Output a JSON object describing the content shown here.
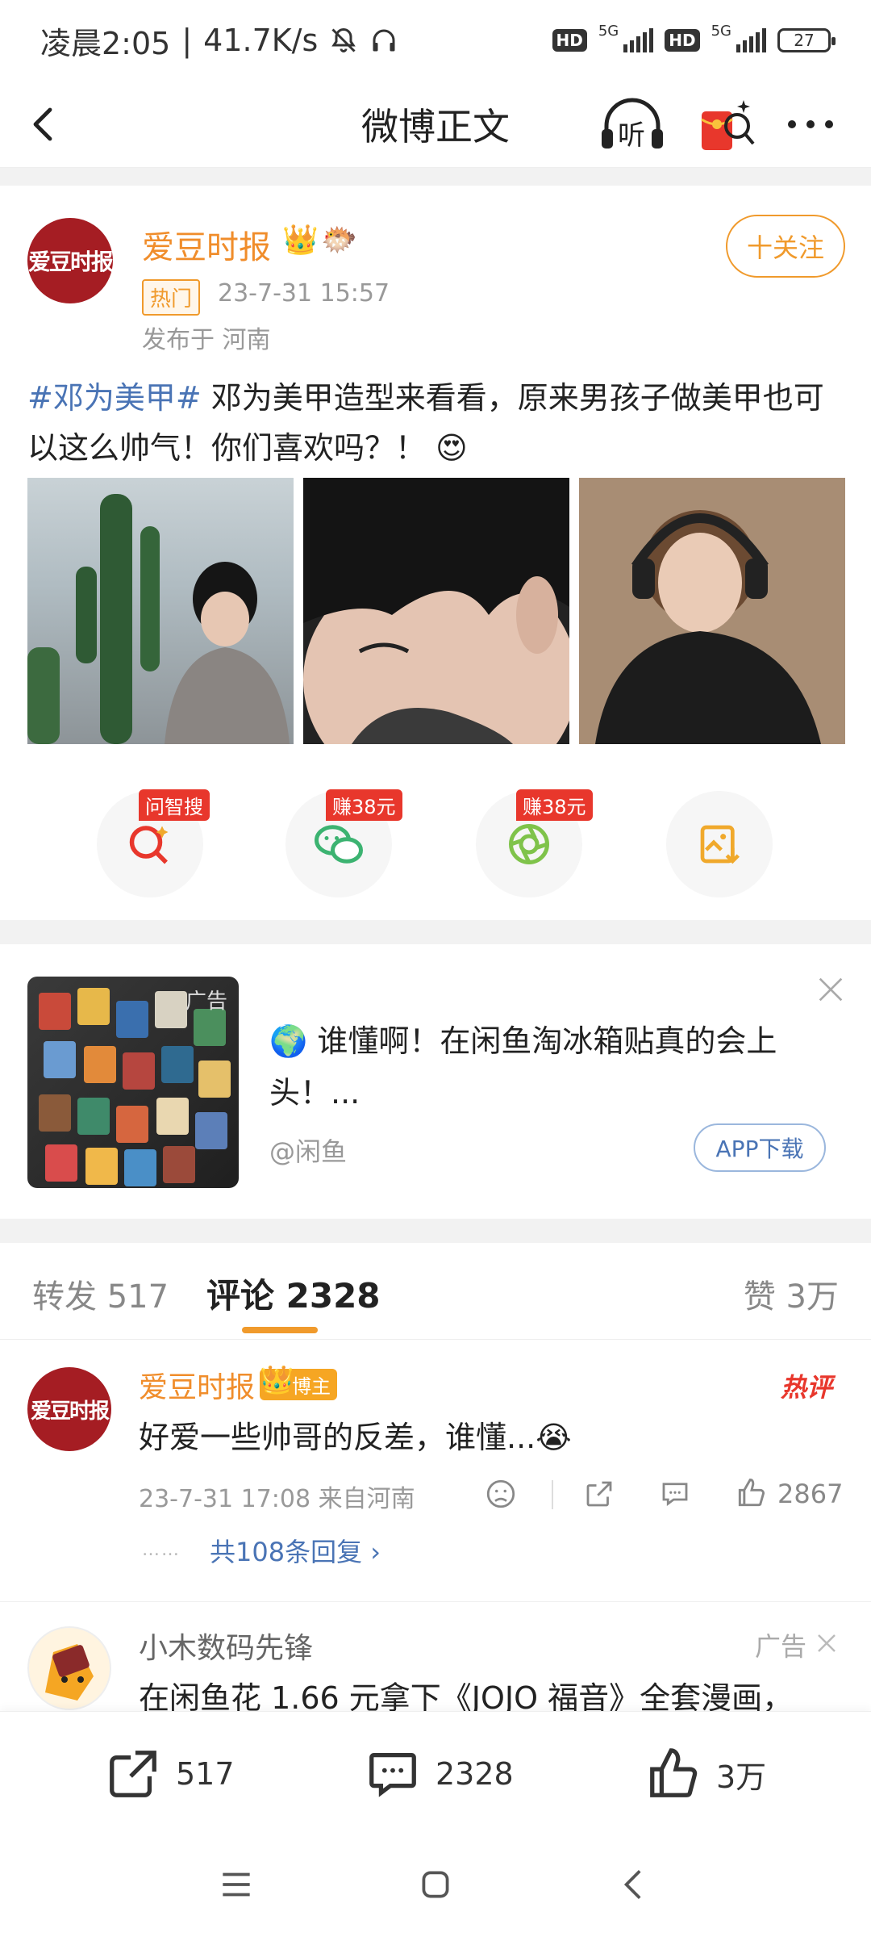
{
  "status": {
    "time": "凌晨2:05",
    "speed": "41.7K/s",
    "net1": "HD",
    "net1_gen": "5G",
    "net2": "HD",
    "net2_gen": "5G",
    "battery": "27",
    "icons": [
      "bell-off-icon",
      "headphones-icon",
      "signal-icon",
      "battery-icon"
    ]
  },
  "navbar": {
    "title": "微博正文",
    "listen_label": "听",
    "icons": [
      "back-icon",
      "listen-icon",
      "red-packet-icon",
      "more-icon"
    ]
  },
  "post": {
    "author": "爱豆时报",
    "avatar_text": "爱豆时报",
    "hot_tag": "热门",
    "time": "23-7-31 15:57",
    "location": "发布于 河南",
    "follow_label": "十关注",
    "topic": "#邓为美甲#",
    "text": " 邓为美甲造型来看看，原来男孩子做美甲也可以这么帅气！你们喜欢吗？！",
    "emoji": "😍",
    "photos": [
      "photo-1",
      "photo-2",
      "photo-3"
    ]
  },
  "share_actions": [
    {
      "badge": "问智搜",
      "icon": "ai-search-icon",
      "color": "#e8372c"
    },
    {
      "badge": "赚38元",
      "icon": "wechat-icon",
      "color": "#3cb371"
    },
    {
      "badge": "赚38元",
      "icon": "moments-icon",
      "color": "#7fc34a"
    },
    {
      "badge": "",
      "icon": "save-image-icon",
      "color": "#f0a92c"
    }
  ],
  "ad": {
    "thumb_label": "广告",
    "globe": "🌍",
    "text": "谁懂啊！在闲鱼淘冰箱贴真的会上头！...",
    "source": "@闲鱼",
    "button": "APP下载"
  },
  "tabs": {
    "forward": "转发 517",
    "comment": "评论 2328",
    "like": "赞 3万"
  },
  "comment": {
    "name": "爱豆时报",
    "badge": "博主",
    "hot": "热评",
    "text": "好爱一些帅哥的反差，谁懂...",
    "emoji": "😭",
    "meta": "23-7-31 17:08  来自河南",
    "likes": "2867",
    "dots": "……",
    "replies": "共108条回复 ›"
  },
  "comment_ad": {
    "name": "小木数码先锋",
    "ad_label": "广告",
    "text": "在闲鱼花 1.66 元拿下《JOJO 福音》全套漫画，"
  },
  "bottom": {
    "forward": "517",
    "comment": "2328",
    "like": "3万"
  }
}
